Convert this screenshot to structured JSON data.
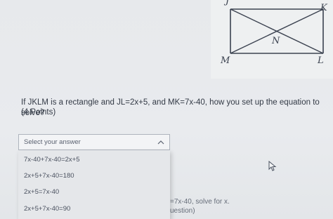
{
  "figure": {
    "labels": {
      "j": "J",
      "k": "K",
      "m": "M",
      "l": "L",
      "n": "N"
    }
  },
  "question": {
    "text": "If JKLM is a rectangle and JL=2x+5, and MK=7x-40, how you set up the equation to solve?",
    "points": "(4 Points)"
  },
  "dropdown": {
    "placeholder": "Select your answer",
    "options": [
      "7x-40+7x-40=2x+5",
      "2x+5+7x-40=180",
      "2x+5=7x-40",
      "2x+5+7x-40=90"
    ]
  },
  "background_fragments": {
    "line1": "=7x-40, solve for x.",
    "line2": "uestion)"
  }
}
